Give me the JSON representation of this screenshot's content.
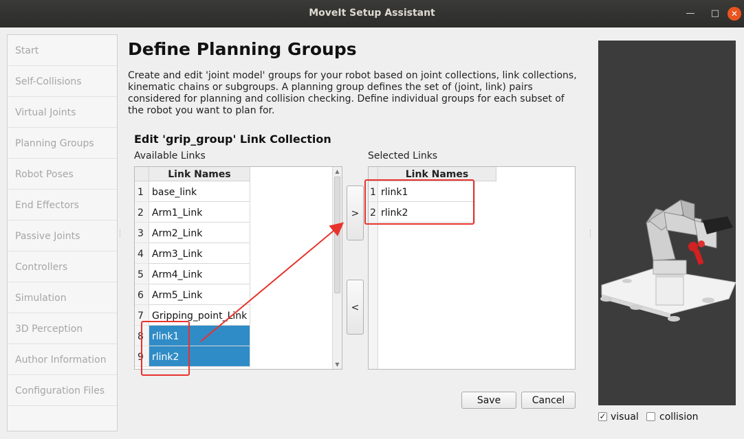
{
  "window": {
    "title": "MoveIt Setup Assistant"
  },
  "nav": {
    "items": [
      "Start",
      "Self-Collisions",
      "Virtual Joints",
      "Planning Groups",
      "Robot Poses",
      "End Effectors",
      "Passive Joints",
      "Controllers",
      "Simulation",
      "3D Perception",
      "Author Information",
      "Configuration Files"
    ]
  },
  "page": {
    "title": "Define Planning Groups",
    "description": "Create and edit 'joint model' groups for your robot based on joint collections, link collections, kinematic chains or subgroups. A planning group defines the set of (joint, link) pairs considered for planning and collision checking. Define individual groups for each subset of the robot you want to plan for.",
    "subtitle": "Edit 'grip_group' Link Collection"
  },
  "available": {
    "label": "Available Links",
    "header": "Link Names",
    "rows": [
      {
        "num": "1",
        "name": "base_link"
      },
      {
        "num": "2",
        "name": "Arm1_Link"
      },
      {
        "num": "3",
        "name": "Arm2_Link"
      },
      {
        "num": "4",
        "name": "Arm3_Link"
      },
      {
        "num": "5",
        "name": "Arm4_Link"
      },
      {
        "num": "6",
        "name": "Arm5_Link"
      },
      {
        "num": "7",
        "name": "Gripping_point_Link"
      },
      {
        "num": "8",
        "name": "rlink1"
      },
      {
        "num": "9",
        "name": "rlink2"
      }
    ],
    "selected_rows": [
      "8",
      "9"
    ]
  },
  "selected": {
    "label": "Selected Links",
    "header": "Link Names",
    "rows": [
      {
        "num": "1",
        "name": "rlink1"
      },
      {
        "num": "2",
        "name": "rlink2"
      }
    ]
  },
  "buttons": {
    "add": ">",
    "remove": "<",
    "save": "Save",
    "cancel": "Cancel"
  },
  "viewport": {
    "visual_label": "visual",
    "visual_checked": true,
    "collision_label": "collision",
    "collision_checked": false
  },
  "annotation_color": "#e8322c",
  "selection_color": "#308cc6"
}
